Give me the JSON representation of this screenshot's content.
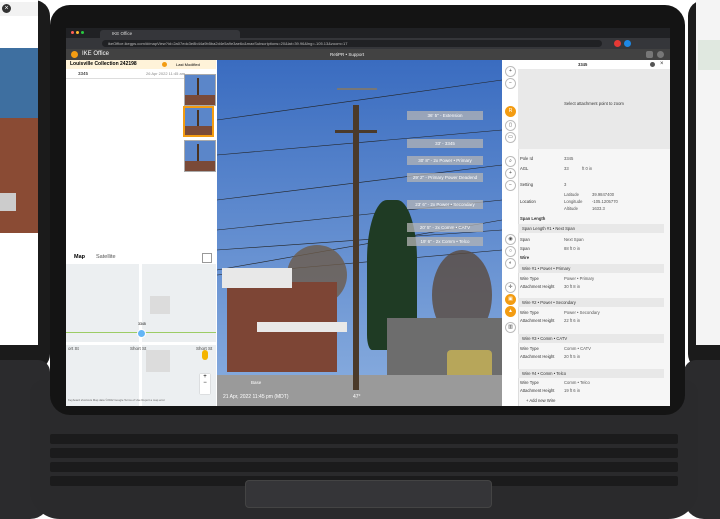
{
  "browser": {
    "tab_title": "IKE Office",
    "url": "ikeOffice.ikegps.com/#/mapView?id=2a07edc3e8b44a9b5ba2d4e5a9e3ae6c&maxSubscriptions=20&lat=39.96&lng=-105.13&zoom=17"
  },
  "app": {
    "title": "IKE Office",
    "center_label": "RetiPR • Support",
    "collection": "Louisville Collection 242198",
    "pole_id": "3345",
    "photo_date_left": "26 Apr 2022 11:45 am",
    "location_status": "Last Modified"
  },
  "map": {
    "tab_map": "Map",
    "tab_satellite": "Satellite",
    "street_1": "Short St",
    "street_2": "Short St",
    "street_3": "ort St",
    "pin_label": "3345",
    "footer": "Keyboard shortcuts   Map data ©2022 Google   Terms of Use   Report a map error",
    "zoom_in": "+",
    "zoom_out": "−"
  },
  "photo": {
    "caption_date": "21 Apr, 2022 11:45 pm (MDT)",
    "caption_base": "Base",
    "caption_angle": "47°",
    "measurements": [
      {
        "label": "36' 5\" - Extension"
      },
      {
        "label": "33' - 3345"
      },
      {
        "label": "30' 8\" - 2x Power • Primary"
      },
      {
        "label": "29' 2\" - Primary Power Deadend"
      },
      {
        "label": "23' 6\" - 2x Power • Secondary"
      },
      {
        "label": "20' 5\" - 2x Comm • CATV"
      },
      {
        "label": "19' 6\" - 2x Comm • Telco"
      }
    ]
  },
  "right_panel": {
    "title": "3345",
    "hint": "Select attachment point to zoom",
    "pole_id_label": "Pole Id",
    "pole_id_value": "3345",
    "agl_label": "AGL",
    "agl_value": "33",
    "agl_unit": "ft  0  in",
    "set_depth_label": "Setting",
    "set_depth_value": "3",
    "location_label": "Location",
    "latitude_label": "Latitude",
    "latitude_value": "39.9847400",
    "longitude_label": "Longitude",
    "longitude_value": "-105.1205770",
    "altitude_label": "Altitude",
    "altitude_value": "1633.3",
    "span_section": "Span Length",
    "span_head": "Span Length #1 • Next Span",
    "span_label": "Span",
    "span_value": "Next Span",
    "span2_label": "Span",
    "span2_value": "88  ft  0  in",
    "wire_section": "Wire",
    "wires": [
      {
        "head": "Wire #1 • Power • Primary",
        "type_label": "Wire Type",
        "type_value": "Power • Primary",
        "height_label": "Attachment Height",
        "height_value": "30  ft  8  in"
      },
      {
        "head": "Wire #2 • Power • Secondary",
        "type_label": "Wire Type",
        "type_value": "Power • Secondary",
        "height_label": "Attachment Height",
        "height_value": "22  ft  6  in"
      },
      {
        "head": "Wire #3 • Comm • CATV",
        "type_label": "Wire Type",
        "type_value": "Comm • CATV",
        "height_label": "Attachment Height",
        "height_value": "20  ft  5  in"
      },
      {
        "head": "Wire #4 • Comm • Telco",
        "type_label": "Wire Type",
        "type_value": "Comm • Telco",
        "height_label": "Attachment Height",
        "height_value": "19  ft  6  in"
      }
    ],
    "add_wire": "+ Add new Wire",
    "footer_span": "Span Length #1 • Next Span"
  },
  "colors": {
    "accent": "#f39c12",
    "app_header": "#424242",
    "sky": "#4a78c4",
    "frame": "#141414"
  }
}
